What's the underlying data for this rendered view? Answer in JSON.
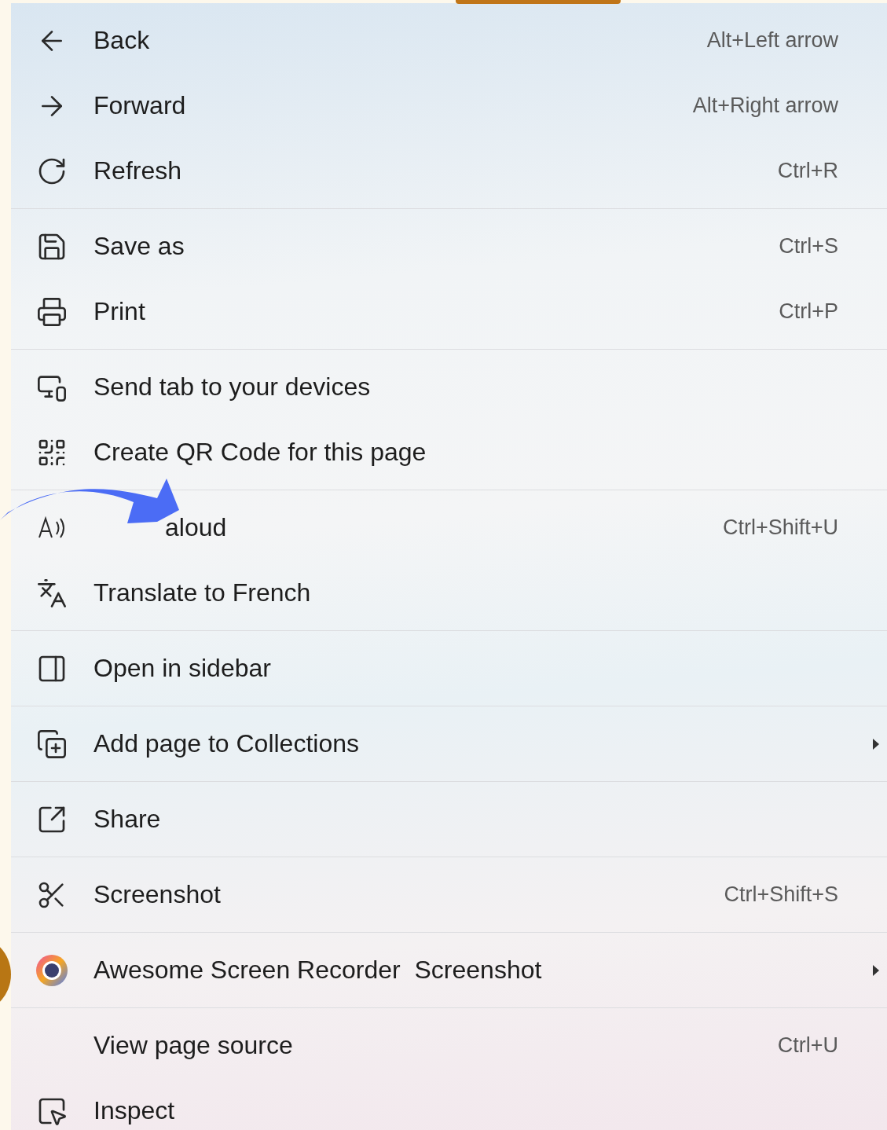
{
  "menu": {
    "groups": [
      {
        "items": [
          {
            "label": "Back",
            "shortcut": "Alt+Left arrow",
            "submenu": false
          },
          {
            "label": "Forward",
            "shortcut": "Alt+Right arrow",
            "submenu": false
          },
          {
            "label": "Refresh",
            "shortcut": "Ctrl+R",
            "submenu": false
          }
        ]
      },
      {
        "items": [
          {
            "label": "Save as",
            "shortcut": "Ctrl+S",
            "submenu": false
          },
          {
            "label": "Print",
            "shortcut": "Ctrl+P",
            "submenu": false
          }
        ]
      },
      {
        "items": [
          {
            "label": "Send tab to your devices",
            "submenu": false
          },
          {
            "label": "Create QR Code for this page",
            "submenu": false
          }
        ]
      },
      {
        "items": [
          {
            "label": "aloud",
            "shortcut": "Ctrl+Shift+U",
            "submenu": false,
            "covered": true
          },
          {
            "label": "Translate to French",
            "submenu": false
          }
        ]
      },
      {
        "items": [
          {
            "label": "Open in sidebar",
            "submenu": false
          }
        ]
      },
      {
        "items": [
          {
            "label": "Add page to Collections",
            "submenu": true
          }
        ]
      },
      {
        "items": [
          {
            "label": "Share",
            "submenu": false
          }
        ]
      },
      {
        "items": [
          {
            "label": "Screenshot",
            "shortcut": "Ctrl+Shift+S",
            "submenu": false
          }
        ]
      },
      {
        "items": [
          {
            "label": "Awesome Screen Recorder  Screenshot",
            "submenu": true
          }
        ]
      },
      {
        "items": [
          {
            "label": "View page source",
            "shortcut": "Ctrl+U",
            "submenu": false
          },
          {
            "label": "Inspect",
            "submenu": false
          }
        ]
      }
    ]
  }
}
